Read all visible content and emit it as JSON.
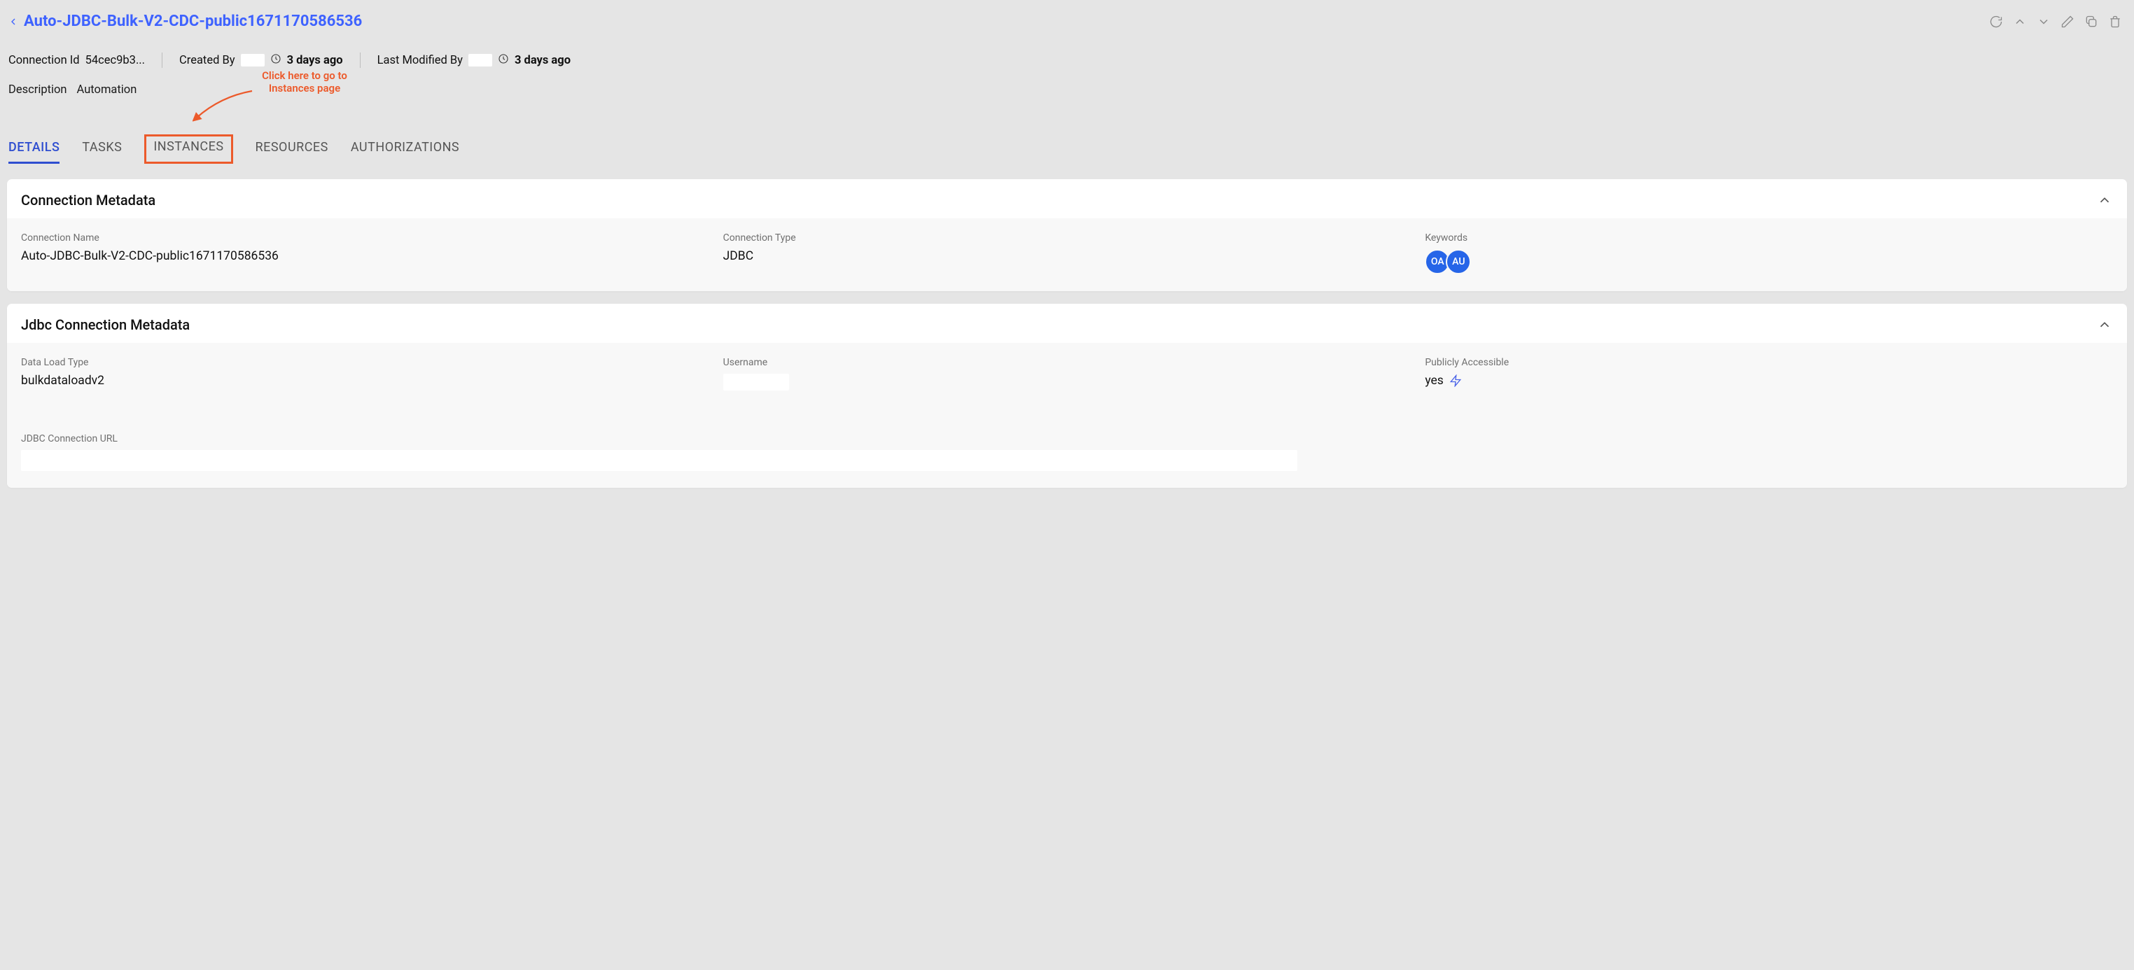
{
  "header": {
    "title": "Auto-JDBC-Bulk-V2-CDC-public1671170586536"
  },
  "meta": {
    "connection_id_label": "Connection Id",
    "connection_id_value": "54cec9b3...",
    "created_by_label": "Created By",
    "created_ago": "3 days ago",
    "last_modified_label": "Last Modified By",
    "last_modified_ago": "3 days ago",
    "description_label": "Description",
    "description_value": "Automation"
  },
  "annotation": {
    "text": "Click here to go to Instances page"
  },
  "tabs": {
    "details": "DETAILS",
    "tasks": "TASKS",
    "instances": "INSTANCES",
    "resources": "RESOURCES",
    "authorizations": "AUTHORIZATIONS"
  },
  "card_conn": {
    "title": "Connection Metadata",
    "fields": {
      "name_label": "Connection Name",
      "name_value": "Auto-JDBC-Bulk-V2-CDC-public1671170586536",
      "type_label": "Connection Type",
      "type_value": "JDBC",
      "keywords_label": "Keywords"
    },
    "keywords": [
      "OA",
      "AU"
    ]
  },
  "card_jdbc": {
    "title": "Jdbc Connection Metadata",
    "fields": {
      "load_label": "Data Load Type",
      "load_value": "bulkdataloadv2",
      "username_label": "Username",
      "public_label": "Publicly Accessible",
      "public_value": "yes",
      "url_label": "JDBC Connection URL"
    }
  },
  "colors": {
    "accent": "#3e62ff",
    "callout": "#ec5a2b",
    "badge": "#2665e8"
  }
}
